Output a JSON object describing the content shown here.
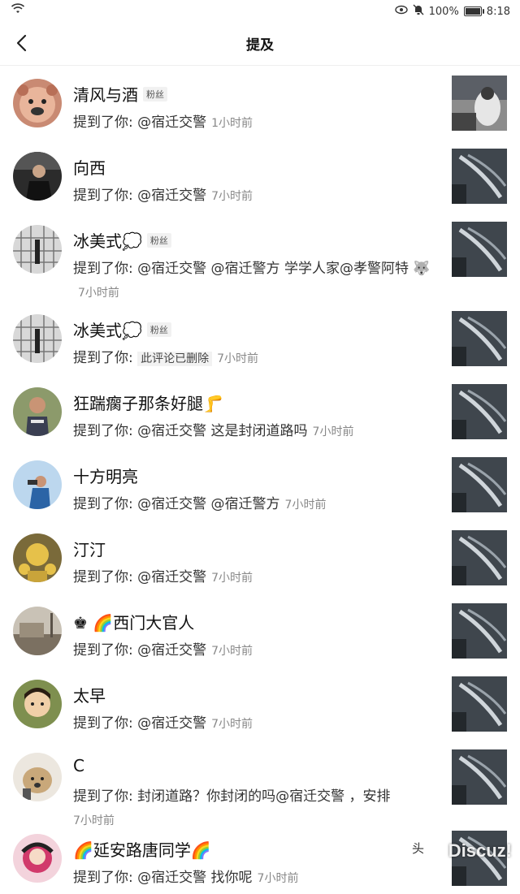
{
  "status_bar": {
    "battery": "100%",
    "time": "8:18"
  },
  "header": {
    "title": "提及"
  },
  "mentions": [
    {
      "name": "清风与酒",
      "fan_badge": "粉丝",
      "message": "提到了你: @宿迁交警",
      "time": "1小时前"
    },
    {
      "name": "向西",
      "fan_badge": "",
      "message": "提到了你: @宿迁交警",
      "time": "7小时前"
    },
    {
      "name": "冰美式💭",
      "fan_badge": "粉丝",
      "message": "提到了你: @宿迁交警 @宿迁警方 学学人家@孝警阿特 🐺",
      "time": "7小时前"
    },
    {
      "name": "冰美式💭",
      "fan_badge": "粉丝",
      "message": "提到了你:",
      "deleted_text": "此评论已删除",
      "time": "7小时前"
    },
    {
      "name": "狂踹瘸子那条好腿🦵",
      "fan_badge": "",
      "message": "提到了你: @宿迁交警 这是封闭道路吗",
      "time": "7小时前"
    },
    {
      "name": "十方明亮",
      "fan_badge": "",
      "message": "提到了你: @宿迁交警 @宿迁警方",
      "time": "7小时前"
    },
    {
      "name": "汀汀",
      "fan_badge": "",
      "message": "提到了你: @宿迁交警",
      "time": "7小时前"
    },
    {
      "name": "♚ 🌈西门大官人",
      "fan_badge": "",
      "message": "提到了你: @宿迁交警",
      "time": "7小时前"
    },
    {
      "name": "太早",
      "fan_badge": "",
      "message": "提到了你: @宿迁交警",
      "time": "7小时前"
    },
    {
      "name": "C",
      "fan_badge": "",
      "message": "提到了你: 封闭道路？你封闭的吗@宿迁交警 ，安排",
      "time": "7小时前"
    },
    {
      "name": "🌈延安路唐同学🌈",
      "fan_badge": "",
      "message": "提到了你: @宿迁交警 找你呢",
      "time": "7小时前"
    }
  ],
  "watermark": {
    "prefix": "头",
    "text": "Discuz!"
  },
  "colors": {
    "text_primary": "#111111",
    "text_secondary": "#333333",
    "time_gray": "#888888"
  }
}
